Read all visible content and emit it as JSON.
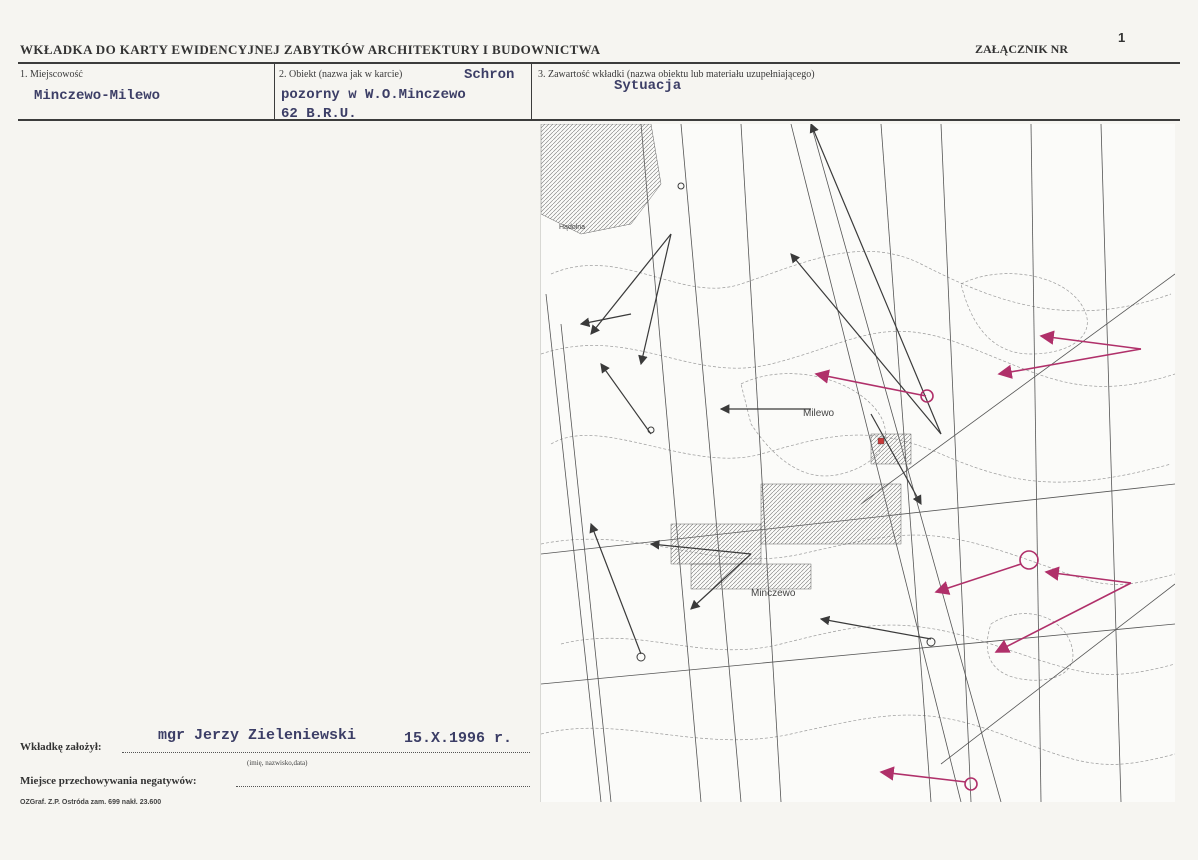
{
  "header": {
    "title": "WKŁADKA DO KARTY EWIDENCYJNEJ ZABYTKÓW ARCHITEKTURY I BUDOWNICTWA",
    "annex_label": "ZAŁĄCZNIK NR",
    "annex_number": "1"
  },
  "fields": {
    "locality": {
      "label": "1. Miejscowość",
      "value": "Minczewo-Milewo"
    },
    "object": {
      "label": "2. Obiekt (nazwa jak w karcie)",
      "value_line1": "Schron",
      "value_line2": "pozorny w W.O.Minczewo",
      "value_line3": "62 B.R.U."
    },
    "content": {
      "label": "3. Zawartość wkładki (nazwa obiektu lub materiału uzupełniającego)",
      "value": "Sytuacja"
    }
  },
  "map": {
    "labels": {
      "milewo": "Milewo",
      "minczewo": "Minczewo",
      "hadolna": "Hądolna"
    },
    "arrow_color": "#b0306a",
    "line_color": "#3a3a3a"
  },
  "bottom": {
    "prepared_label": "Wkładkę założył:",
    "prepared_value": "mgr Jerzy Zieleniewski",
    "prepared_date": "15.X.1996 r.",
    "prepared_hint": "(imię, nazwisko,data)",
    "storage_label": "Miejsce przechowywania negatywów:",
    "footer": "OZGraf. Z.P. Ostróda zam. 699 nakł. 23.600"
  }
}
